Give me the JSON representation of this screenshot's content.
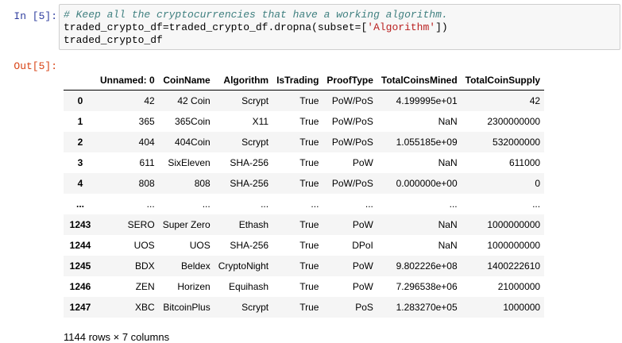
{
  "input_prompt": "In [5]:",
  "output_prompt": "Out[5]:",
  "code": {
    "comment": "# Keep all the cryptocurrencies that have a working algorithm.",
    "line2_pre": "traded_crypto_df=traded_crypto_df.dropna(subset=[",
    "line2_str": "'Algorithm'",
    "line2_post": "])",
    "line3": "traded_crypto_df"
  },
  "table": {
    "columns": [
      "",
      "Unnamed: 0",
      "CoinName",
      "Algorithm",
      "IsTrading",
      "ProofType",
      "TotalCoinsMined",
      "TotalCoinSupply"
    ],
    "rows": [
      [
        "0",
        "42",
        "42 Coin",
        "Scrypt",
        "True",
        "PoW/PoS",
        "4.199995e+01",
        "42"
      ],
      [
        "1",
        "365",
        "365Coin",
        "X11",
        "True",
        "PoW/PoS",
        "NaN",
        "2300000000"
      ],
      [
        "2",
        "404",
        "404Coin",
        "Scrypt",
        "True",
        "PoW/PoS",
        "1.055185e+09",
        "532000000"
      ],
      [
        "3",
        "611",
        "SixEleven",
        "SHA-256",
        "True",
        "PoW",
        "NaN",
        "611000"
      ],
      [
        "4",
        "808",
        "808",
        "SHA-256",
        "True",
        "PoW/PoS",
        "0.000000e+00",
        "0"
      ],
      [
        "...",
        "...",
        "...",
        "...",
        "...",
        "...",
        "...",
        "..."
      ],
      [
        "1243",
        "SERO",
        "Super Zero",
        "Ethash",
        "True",
        "PoW",
        "NaN",
        "1000000000"
      ],
      [
        "1244",
        "UOS",
        "UOS",
        "SHA-256",
        "True",
        "DPoI",
        "NaN",
        "1000000000"
      ],
      [
        "1245",
        "BDX",
        "Beldex",
        "CryptoNight",
        "True",
        "PoW",
        "9.802226e+08",
        "1400222610"
      ],
      [
        "1246",
        "ZEN",
        "Horizen",
        "Equihash",
        "True",
        "PoW",
        "7.296538e+06",
        "21000000"
      ],
      [
        "1247",
        "XBC",
        "BitcoinPlus",
        "Scrypt",
        "True",
        "PoS",
        "1.283270e+05",
        "1000000"
      ]
    ]
  },
  "shape_text": "1144 rows × 7 columns"
}
